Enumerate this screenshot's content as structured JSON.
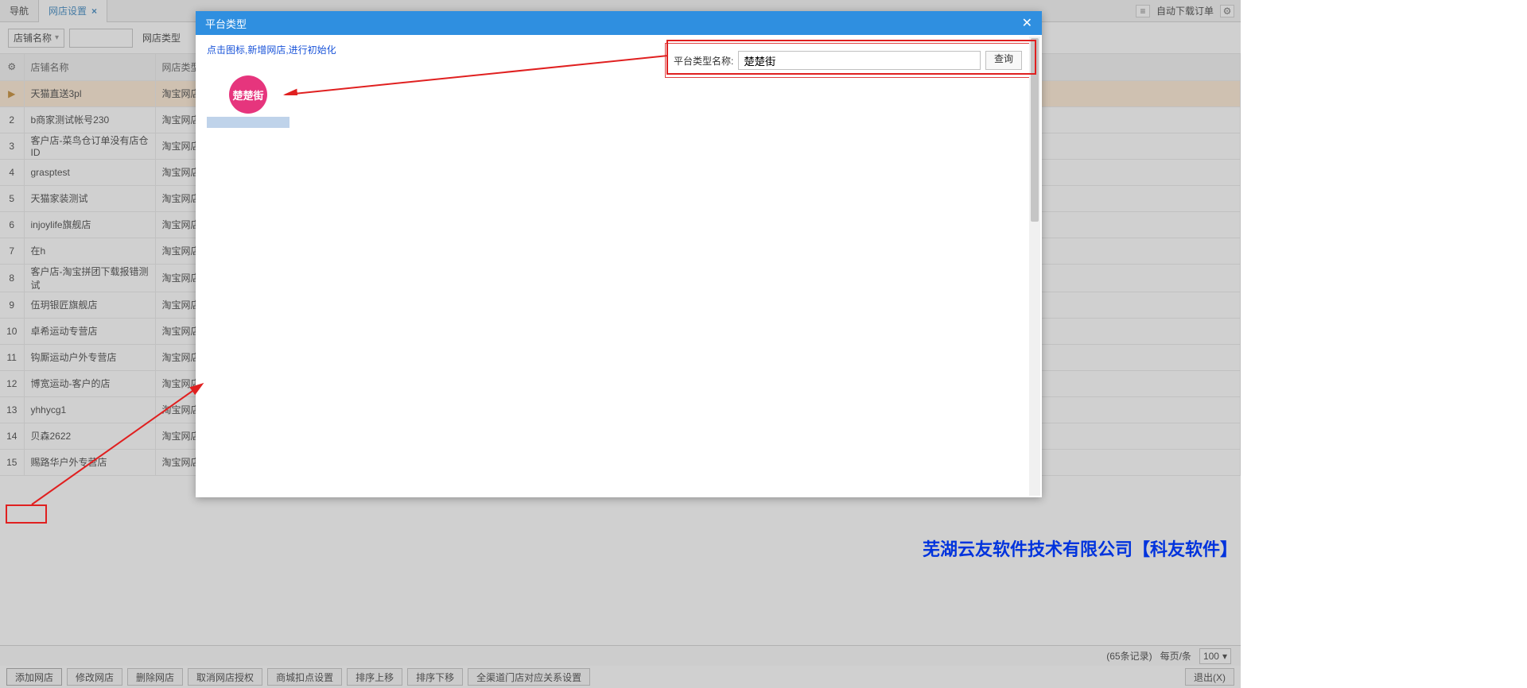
{
  "tabs": {
    "nav": "导航",
    "active": "网店设置"
  },
  "topRight": {
    "download": "自动下载订单"
  },
  "filter": {
    "field_select": "店铺名称",
    "platform_label": "网店类型"
  },
  "tableHeader": {
    "name": "店铺名称",
    "type": "网店类型"
  },
  "rows": [
    {
      "num": "▶",
      "name": "天猫直送3pl",
      "type": "淘宝网店",
      "selected": true
    },
    {
      "num": "2",
      "name": "b商家测试帐号230",
      "type": "淘宝网店"
    },
    {
      "num": "3",
      "name": "客户店-菜鸟仓订单没有店仓ID",
      "type": "淘宝网店"
    },
    {
      "num": "4",
      "name": "grasptest",
      "type": "淘宝网店"
    },
    {
      "num": "5",
      "name": "天猫家装测试",
      "type": "淘宝网店"
    },
    {
      "num": "6",
      "name": "injoylife旗舰店",
      "type": "淘宝网店"
    },
    {
      "num": "7",
      "name": "在h",
      "type": "淘宝网店"
    },
    {
      "num": "8",
      "name": "客户店-淘宝拼团下载报错测试",
      "type": "淘宝网店"
    },
    {
      "num": "9",
      "name": "伍玥银匠旗舰店",
      "type": "淘宝网店"
    },
    {
      "num": "10",
      "name": "卓希运动专营店",
      "type": "淘宝网店"
    },
    {
      "num": "11",
      "name": "钩厮运动户外专营店",
      "type": "淘宝网店"
    },
    {
      "num": "12",
      "name": "博宽运动-客户的店",
      "type": "淘宝网店"
    },
    {
      "num": "13",
      "name": "yhhycg1",
      "type": "淘宝网店"
    },
    {
      "num": "14",
      "name": "贝森2622",
      "type": "淘宝网店"
    },
    {
      "num": "15",
      "name": "赐路华户外专营店",
      "type": "淘宝网店"
    }
  ],
  "statusBar": {
    "count": "(65条记录)",
    "perPage": "每页/条",
    "perPageValue": "100"
  },
  "actions": {
    "add": "添加网店",
    "edit": "修改网店",
    "delete": "删除网店",
    "revoke": "取消网店授权",
    "mallDeduct": "商城扣点设置",
    "moveUp": "排序上移",
    "moveDown": "排序下移",
    "channelRel": "全渠道门店对应关系设置",
    "exit": "退出(X)"
  },
  "modal": {
    "title": "平台类型",
    "hint": "点击图标,新增网店,进行初始化",
    "searchLabel": "平台类型名称:",
    "searchValue": "楚楚街",
    "searchBtn": "查询",
    "platformName": "楚楚街"
  },
  "watermark": "芜湖云友软件技术有限公司【科友软件】"
}
